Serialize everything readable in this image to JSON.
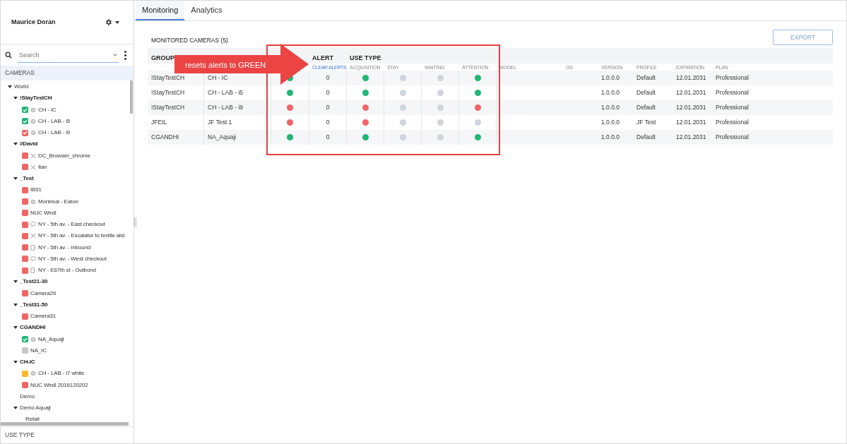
{
  "sidebar": {
    "user": "Maurice Doran",
    "search": {
      "placeholder": "Search"
    },
    "section": "CAMERAS",
    "footer": "USE TYPE",
    "tree": [
      {
        "label": "World",
        "kind": "folder",
        "expanded": true,
        "children": [
          {
            "label": "!StayTestCH",
            "kind": "group",
            "expanded": true,
            "children": [
              {
                "label": "CH - IC",
                "kind": "sensor",
                "color": "#22b573",
                "checked": true
              },
              {
                "label": "CH - LAB - i5",
                "kind": "sensor",
                "color": "#22b573",
                "checked": true
              },
              {
                "label": "CH - LAB - i9",
                "kind": "sensor",
                "color": "#f06565",
                "checked": true
              }
            ]
          },
          {
            "label": "#David",
            "kind": "group",
            "expanded": true,
            "children": [
              {
                "label": "DC_Browser_chrome",
                "kind": "tools",
                "color": "#f06565",
                "checked": false
              },
              {
                "label": "Ilan",
                "kind": "tools",
                "color": "#f06565",
                "checked": false
              }
            ]
          },
          {
            "label": "_Test",
            "kind": "group",
            "expanded": true,
            "children": [
              {
                "label": "IB51",
                "kind": "plain",
                "color": "#f06565",
                "checked": false
              },
              {
                "label": "Montreal - Eaton",
                "kind": "sensor",
                "color": "#f06565",
                "checked": false
              },
              {
                "label": "NUC Win8",
                "kind": "plain",
                "color": "#f06565",
                "checked": false
              },
              {
                "label": "NY - 5th av. - East checkout",
                "kind": "chat",
                "color": "#f06565",
                "checked": false
              },
              {
                "label": "NY - 5th av. - Escalator to textile aisl",
                "kind": "tools",
                "color": "#f06565",
                "checked": false
              },
              {
                "label": "NY - 5th av. - Inbound",
                "kind": "door",
                "color": "#f06565",
                "checked": false
              },
              {
                "label": "NY - 5th av. - West checkout",
                "kind": "chat",
                "color": "#f06565",
                "checked": false
              },
              {
                "label": "NY - E67th st - Outbond",
                "kind": "door",
                "color": "#f06565",
                "checked": false
              }
            ]
          },
          {
            "label": "_Test21-30",
            "kind": "group",
            "expanded": true,
            "children": [
              {
                "label": "Camera29",
                "kind": "plain",
                "color": "#f06565",
                "checked": false
              }
            ]
          },
          {
            "label": "_Test31-50",
            "kind": "group",
            "expanded": true,
            "children": [
              {
                "label": "Camera31",
                "kind": "plain",
                "color": "#f06565",
                "checked": false
              }
            ]
          },
          {
            "label": "CGANDHI",
            "kind": "group",
            "expanded": true,
            "children": [
              {
                "label": "NA_Aquaji",
                "kind": "sensor",
                "color": "#22b573",
                "checked": true
              },
              {
                "label": "NA_IC",
                "kind": "plain",
                "color": "#c6c6c6",
                "checked": false
              }
            ]
          },
          {
            "label": "CH-IC",
            "kind": "group",
            "expanded": true,
            "children": [
              {
                "label": "CH - LAB - i7 white",
                "kind": "sensor",
                "color": "#fbb829",
                "checked": false
              },
              {
                "label": "NUC Win8 2016120202",
                "kind": "plain",
                "color": "#f06565",
                "checked": false
              }
            ]
          },
          {
            "label": "Demo",
            "kind": "folder",
            "expanded": false
          },
          {
            "label": "Demo Aquaji",
            "kind": "folder",
            "expanded": true,
            "children": [
              {
                "label": "Retail",
                "kind": "folder",
                "expanded": false
              }
            ]
          }
        ]
      }
    ]
  },
  "tabs": [
    {
      "label": "Monitoring",
      "selected": true
    },
    {
      "label": "Analytics",
      "selected": false
    }
  ],
  "title": "MONITORED CAMERAS (5)",
  "export_button": "EXPORT",
  "table": {
    "header": [
      {
        "kind": "text",
        "label": "GROUP"
      },
      {
        "kind": "blank"
      },
      {
        "kind": "blank"
      },
      {
        "kind": "text",
        "label": "ALERT"
      },
      {
        "kind": "text",
        "label": "USE TYPE"
      }
    ],
    "subheader": [
      {
        "kind": "blank"
      },
      {
        "kind": "blank"
      },
      {
        "kind": "blank"
      },
      {
        "kind": "link",
        "label": "CLEAR ALERTS"
      },
      {
        "kind": "text",
        "label": "ACQUISITION"
      },
      {
        "kind": "text",
        "label": "STAY"
      },
      {
        "kind": "text",
        "label": "WAITING"
      },
      {
        "kind": "text",
        "label": "ATTENTION"
      },
      {
        "kind": "text",
        "label": "MODEL"
      },
      {
        "kind": "text",
        "label": "OS"
      },
      {
        "kind": "text",
        "label": "VERSION"
      },
      {
        "kind": "text",
        "label": "PROFILE"
      },
      {
        "kind": "text",
        "label": "EXPIRATION"
      },
      {
        "kind": "text",
        "label": "PLAN"
      }
    ],
    "rows": [
      {
        "group": "!StayTestCH",
        "camera": "CH - IC",
        "status": {
          "color": "#22b573"
        },
        "alert": "0",
        "acquisition": {
          "color": "#22b573"
        },
        "stay": {
          "color": "#cfd5df"
        },
        "waiting": {
          "color": "#cfd5df"
        },
        "attention": {
          "color": "#22b573"
        },
        "version": "1.0.0.0",
        "profile": "Default",
        "expiration": "12.01.2031",
        "plan": "Professional"
      },
      {
        "group": "!StayTestCH",
        "camera": "CH - LAB - i5",
        "status": {
          "color": "#22b573"
        },
        "alert": "0",
        "acquisition": {
          "color": "#22b573"
        },
        "stay": {
          "color": "#cfd5df"
        },
        "waiting": {
          "color": "#cfd5df"
        },
        "attention": {
          "color": "#22b573"
        },
        "version": "1.0.0.0",
        "profile": "Default",
        "expiration": "12.01.2031",
        "plan": "Professional"
      },
      {
        "group": "!StayTestCH",
        "camera": "CH - LAB - i9",
        "status": {
          "color": "#f06565"
        },
        "alert": "0",
        "acquisition": {
          "color": "#f06565"
        },
        "stay": {
          "color": "#cfd5df"
        },
        "waiting": {
          "color": "#cfd5df"
        },
        "attention": {
          "color": "#f06565"
        },
        "version": "1.0.0.0",
        "profile": "Default",
        "expiration": "12.01.2031",
        "plan": "Professional"
      },
      {
        "group": "JFEIL",
        "camera": "JF Test 1",
        "status": {
          "color": "#f06565"
        },
        "alert": "0",
        "acquisition": {
          "color": "#f06565"
        },
        "stay": {
          "color": "#cfd5df"
        },
        "waiting": {
          "color": "#cfd5df"
        },
        "attention": {
          "color": "#cfd5df"
        },
        "version": "1.0.0.0",
        "profile": "JF Test",
        "expiration": "12.01.2031",
        "plan": "Professional"
      },
      {
        "group": "CGANDHI",
        "camera": "NA_Aquaji",
        "status": {
          "color": "#22b573"
        },
        "alert": "0",
        "acquisition": {
          "color": "#22b573"
        },
        "stay": {
          "color": "#cfd5df"
        },
        "waiting": {
          "color": "#cfd5df"
        },
        "attention": {
          "color": "#22b573"
        },
        "version": "1.0.0.0",
        "profile": "Default",
        "expiration": "12.01.2031",
        "plan": "Professional"
      }
    ]
  },
  "annotation": {
    "text": "resets alerts to GREEN"
  }
}
